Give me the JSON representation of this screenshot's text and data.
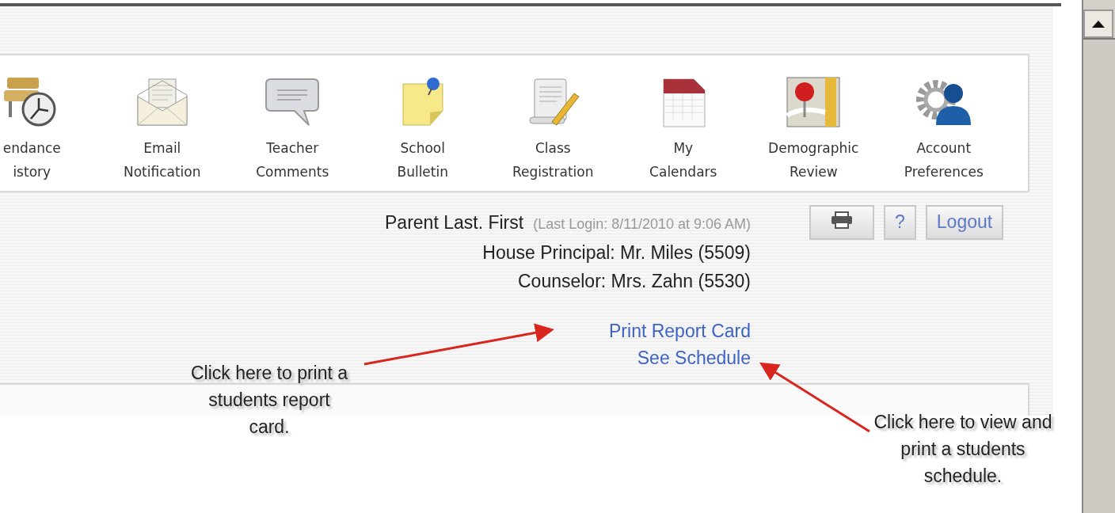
{
  "nav_items": [
    {
      "kind": "attendance",
      "lines": [
        "endance",
        "istory"
      ]
    },
    {
      "kind": "email",
      "lines": [
        "Email",
        "Notification"
      ]
    },
    {
      "kind": "comments",
      "lines": [
        "Teacher",
        "Comments"
      ]
    },
    {
      "kind": "bulletin",
      "lines": [
        "School",
        "Bulletin"
      ]
    },
    {
      "kind": "registration",
      "lines": [
        "Class",
        "Registration"
      ]
    },
    {
      "kind": "calendar",
      "lines": [
        "My",
        "Calendars"
      ]
    },
    {
      "kind": "map",
      "lines": [
        "Demographic",
        "Review"
      ]
    },
    {
      "kind": "account",
      "lines": [
        "Account",
        "Preferences"
      ]
    }
  ],
  "user": {
    "name": "Parent Last. First",
    "last_login": "(Last Login: 8/11/2010 at 9:06 AM)",
    "details": [
      "House Principal: Mr. Miles (5509)",
      "Counselor: Mrs. Zahn (5530)"
    ]
  },
  "links": [
    "Print Report Card",
    "See Schedule"
  ],
  "buttons": [
    {
      "kind": "print"
    },
    {
      "kind": "help",
      "label": "?"
    },
    {
      "kind": "text",
      "label": "Logout"
    }
  ],
  "annotations": [
    {
      "kind": "left",
      "text": "Click here to print a students report card."
    },
    {
      "kind": "right",
      "text": "Click here to view and print a students schedule."
    }
  ]
}
